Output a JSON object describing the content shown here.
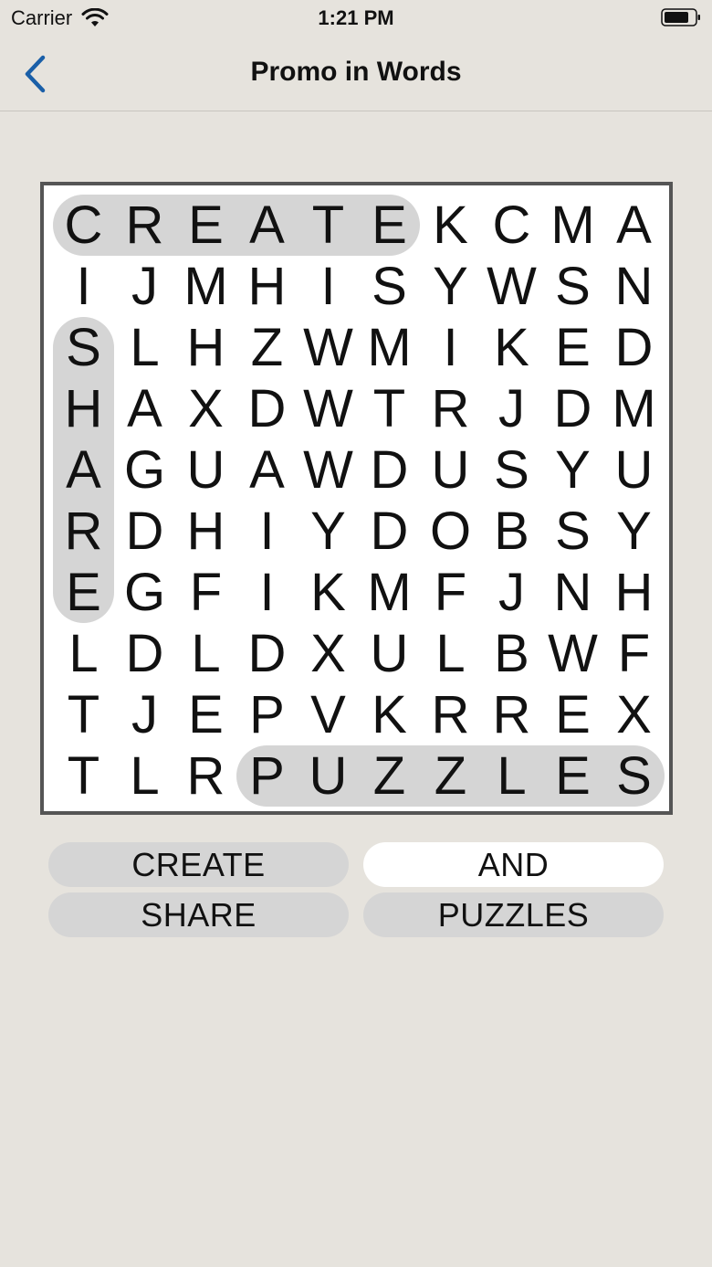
{
  "status_bar": {
    "carrier": "Carrier",
    "time": "1:21 PM"
  },
  "nav": {
    "title": "Promo in Words",
    "back_icon": "chevron-left-icon",
    "accent_color": "#1a5fa8"
  },
  "grid": {
    "rows": [
      [
        "C",
        "R",
        "E",
        "A",
        "T",
        "E",
        "K",
        "C",
        "M",
        "A"
      ],
      [
        "I",
        "J",
        "M",
        "H",
        "I",
        "S",
        "Y",
        "W",
        "S",
        "N"
      ],
      [
        "S",
        "L",
        "H",
        "Z",
        "W",
        "M",
        "I",
        "K",
        "E",
        "D"
      ],
      [
        "H",
        "A",
        "X",
        "D",
        "W",
        "T",
        "R",
        "J",
        "D",
        "M"
      ],
      [
        "A",
        "G",
        "U",
        "A",
        "W",
        "D",
        "U",
        "S",
        "Y",
        "U"
      ],
      [
        "R",
        "D",
        "H",
        "I",
        "Y",
        "D",
        "O",
        "B",
        "S",
        "Y"
      ],
      [
        "E",
        "G",
        "F",
        "I",
        "K",
        "M",
        "F",
        "J",
        "N",
        "H"
      ],
      [
        "L",
        "D",
        "L",
        "D",
        "X",
        "U",
        "L",
        "B",
        "W",
        "F"
      ],
      [
        "T",
        "J",
        "E",
        "P",
        "V",
        "K",
        "R",
        "R",
        "E",
        "X"
      ],
      [
        "T",
        "L",
        "R",
        "P",
        "U",
        "Z",
        "Z",
        "L",
        "E",
        "S"
      ]
    ],
    "found": [
      {
        "word": "CREATE",
        "row": 0,
        "col": 0,
        "dir": "horizontal",
        "length": 6
      },
      {
        "word": "SHARE",
        "row": 2,
        "col": 0,
        "dir": "vertical",
        "length": 5
      },
      {
        "word": "PUZZLES",
        "row": 9,
        "col": 3,
        "dir": "horizontal",
        "length": 7
      }
    ],
    "highlight_color": "#d5d5d5"
  },
  "words": [
    {
      "label": "CREATE",
      "found": true
    },
    {
      "label": "AND",
      "found": false
    },
    {
      "label": "SHARE",
      "found": true
    },
    {
      "label": "PUZZLES",
      "found": true
    }
  ]
}
